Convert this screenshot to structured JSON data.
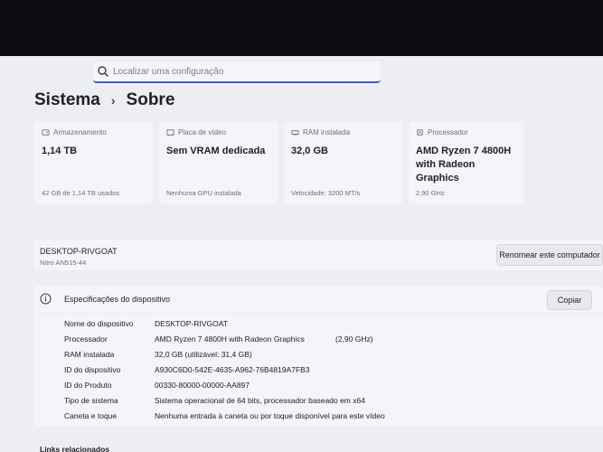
{
  "search": {
    "placeholder": "Localizar uma configuração"
  },
  "breadcrumb": {
    "parent": "Sistema",
    "separator": "›",
    "current": "Sobre"
  },
  "cards": [
    {
      "label": "Armazenamento",
      "value": "1,14 TB",
      "sub": "42 GB de 1,14 TB usados",
      "icon": "storage-icon"
    },
    {
      "label": "Placa de vídeo",
      "value": "Sem VRAM dedicada",
      "sub": "Nenhuma GPU instalada",
      "icon": "gpu-icon"
    },
    {
      "label": "RAM instalada",
      "value": "32,0 GB",
      "sub": "Velocidade: 3200 MT/s",
      "icon": "ram-icon"
    },
    {
      "label": "Processador",
      "value": "AMD Ryzen 7 4800H with Radeon Graphics",
      "sub": "2,90 GHz",
      "icon": "cpu-icon"
    }
  ],
  "device": {
    "name": "DESKTOP-RIVGOAT",
    "model": "Nitro AN515-44",
    "rename_label": "Renomear este computador"
  },
  "specs": {
    "title": "Especificações do dispositivo",
    "copy_label": "Copiar",
    "rows": [
      {
        "key": "Nome do dispositivo",
        "value": "DESKTOP-RIVGOAT",
        "extra": ""
      },
      {
        "key": "Processador",
        "value": "AMD Ryzen 7 4800H with Radeon Graphics",
        "extra": "(2,90 GHz)"
      },
      {
        "key": "RAM instalada",
        "value": "32,0 GB (utilizável: 31,4 GB)",
        "extra": ""
      },
      {
        "key": "ID do dispositivo",
        "value": "A930C6D0-542E-4635-A962-76B4819A7FB3",
        "extra": ""
      },
      {
        "key": "ID do Produto",
        "value": "00330-80000-00000-AA897",
        "extra": ""
      },
      {
        "key": "Tipo de sistema",
        "value": "Sistema operacional de 64 bits, processador baseado em x64",
        "extra": ""
      },
      {
        "key": "Caneta e toque",
        "value": "Nenhuma entrada à caneta ou por toque disponível para este vídeo",
        "extra": ""
      }
    ]
  },
  "related": {
    "label": "Links relacionados"
  },
  "colors": {
    "accent": "#3c5cc8",
    "background": "#eceef2",
    "card": "#f4f5f8",
    "bezel": "#0b0c0f"
  }
}
